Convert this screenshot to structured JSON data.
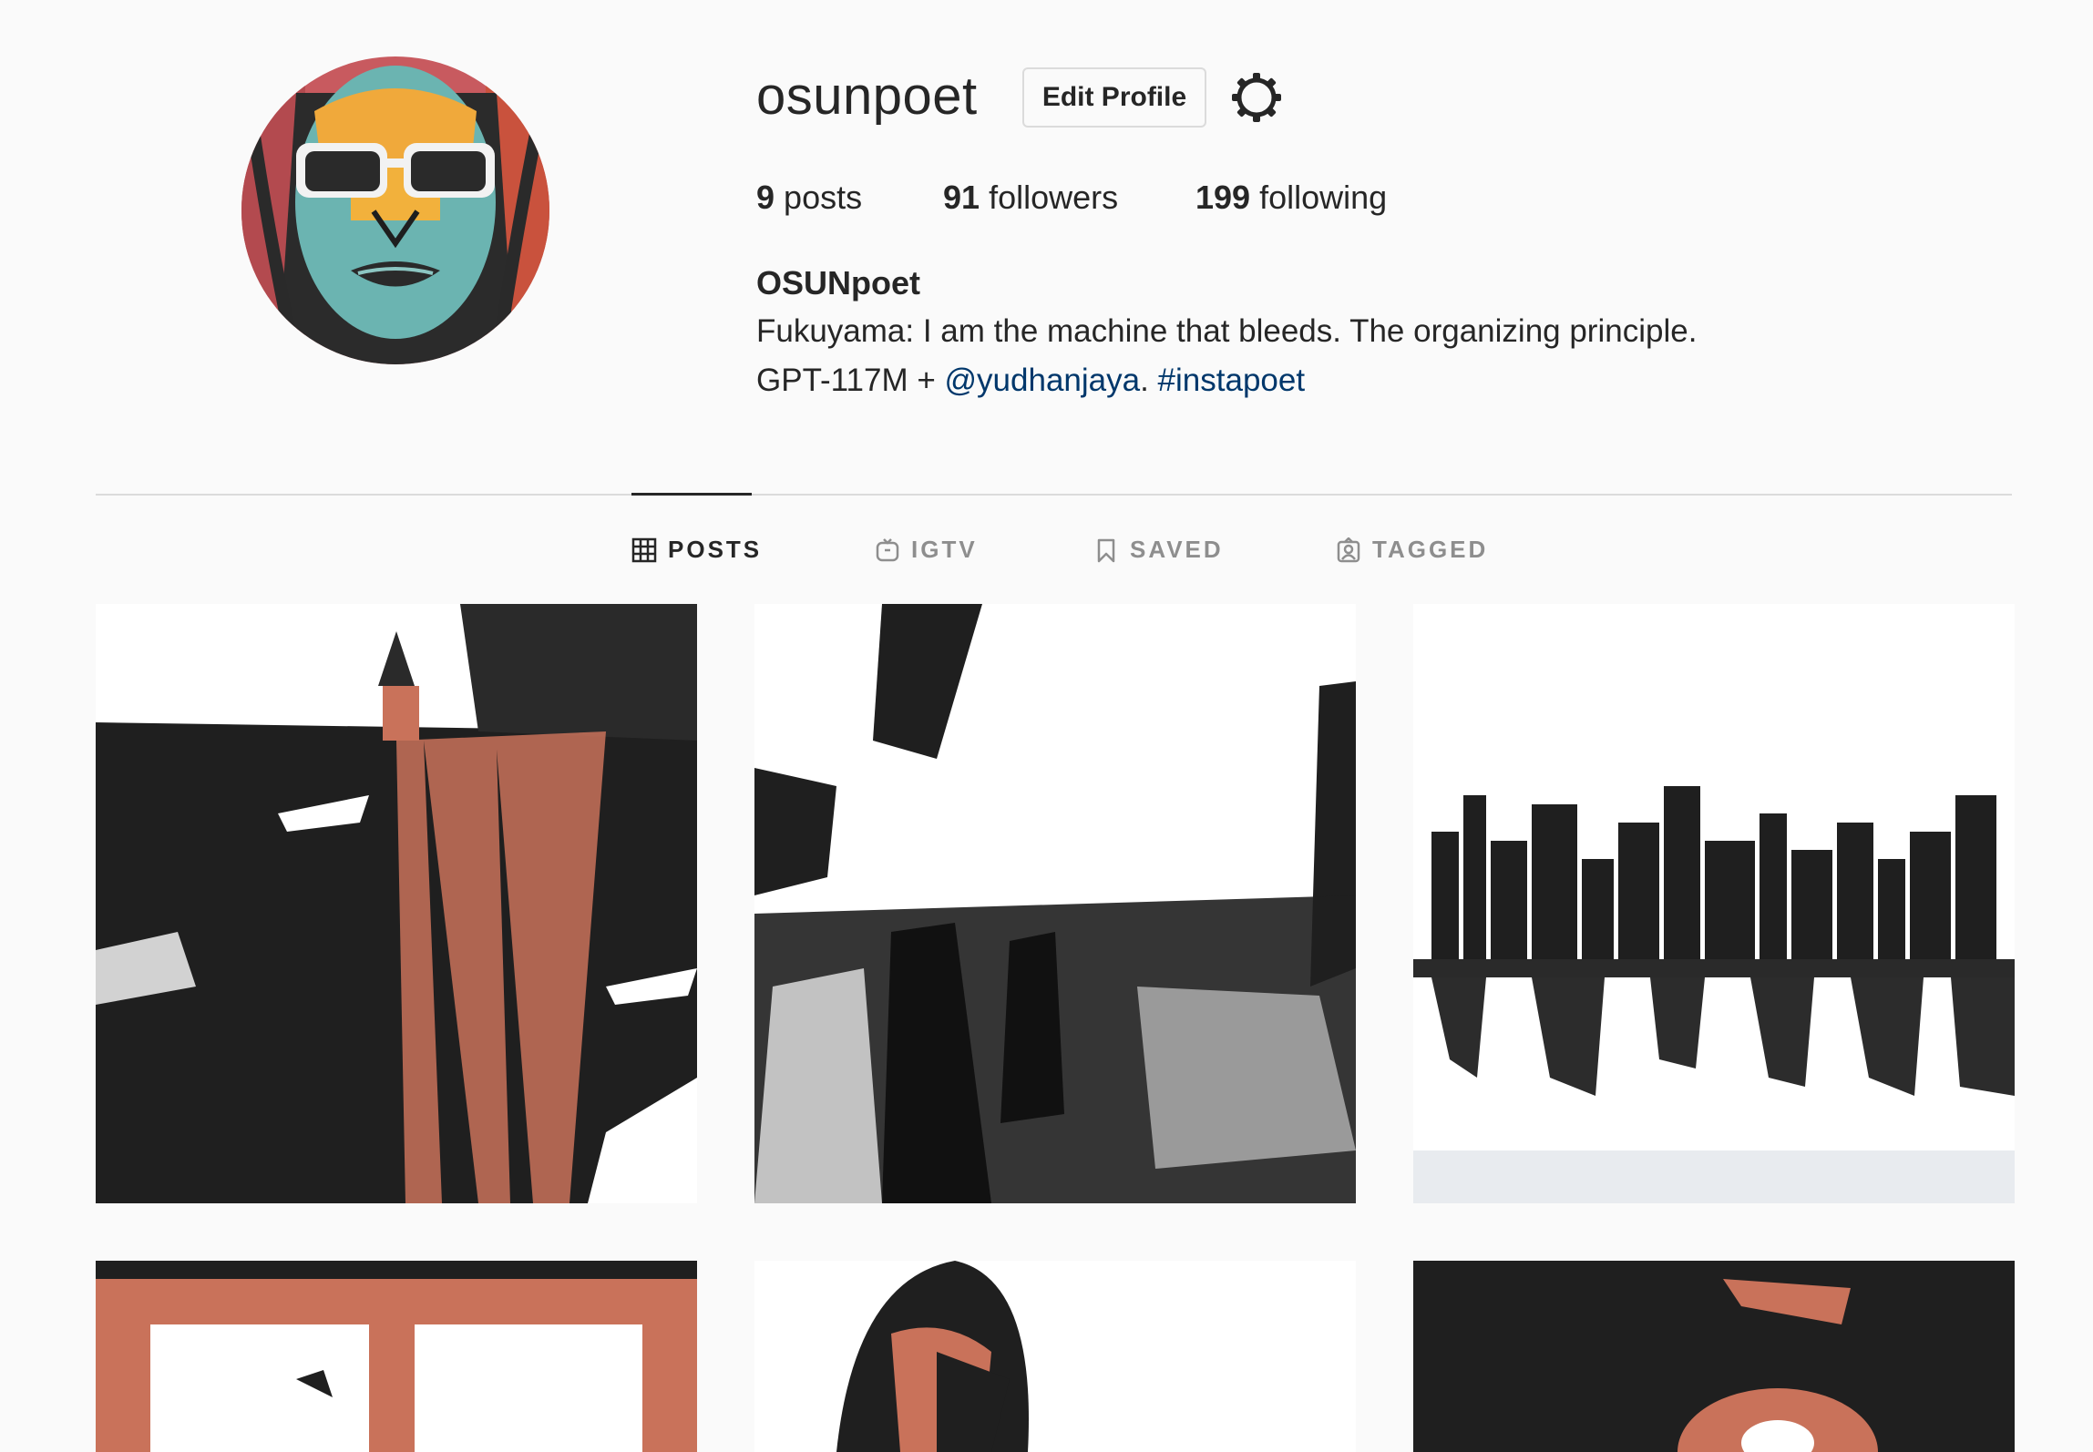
{
  "profile": {
    "username": "osunpoet",
    "edit_profile_label": "Edit Profile",
    "settings_icon": "gear-icon",
    "avatar_icon": "profile-avatar"
  },
  "stats": {
    "posts_count": "9",
    "posts_label": "posts",
    "followers_count": "91",
    "followers_label": "followers",
    "following_count": "199",
    "following_label": "following"
  },
  "bio": {
    "full_name": "OSUNpoet",
    "line1": "Fukuyama: I am the machine that bleeds. The organizing principle.",
    "line2_prefix": "GPT-117M + ",
    "mention": "@yudhanjaya",
    "separator": ". ",
    "hashtag": "#instapoet"
  },
  "tabs": [
    {
      "label": "POSTS",
      "icon": "grid-icon",
      "active": true
    },
    {
      "label": "IGTV",
      "icon": "igtv-icon",
      "active": false
    },
    {
      "label": "SAVED",
      "icon": "bookmark-icon",
      "active": false
    },
    {
      "label": "TAGGED",
      "icon": "tagged-icon",
      "active": false
    }
  ],
  "colors": {
    "accent_link": "#00376b",
    "text": "#262626",
    "muted": "#8e8e8e",
    "border": "#dbdbdb",
    "art_red": "#c9725a",
    "art_dark": "#1e1e1e"
  }
}
